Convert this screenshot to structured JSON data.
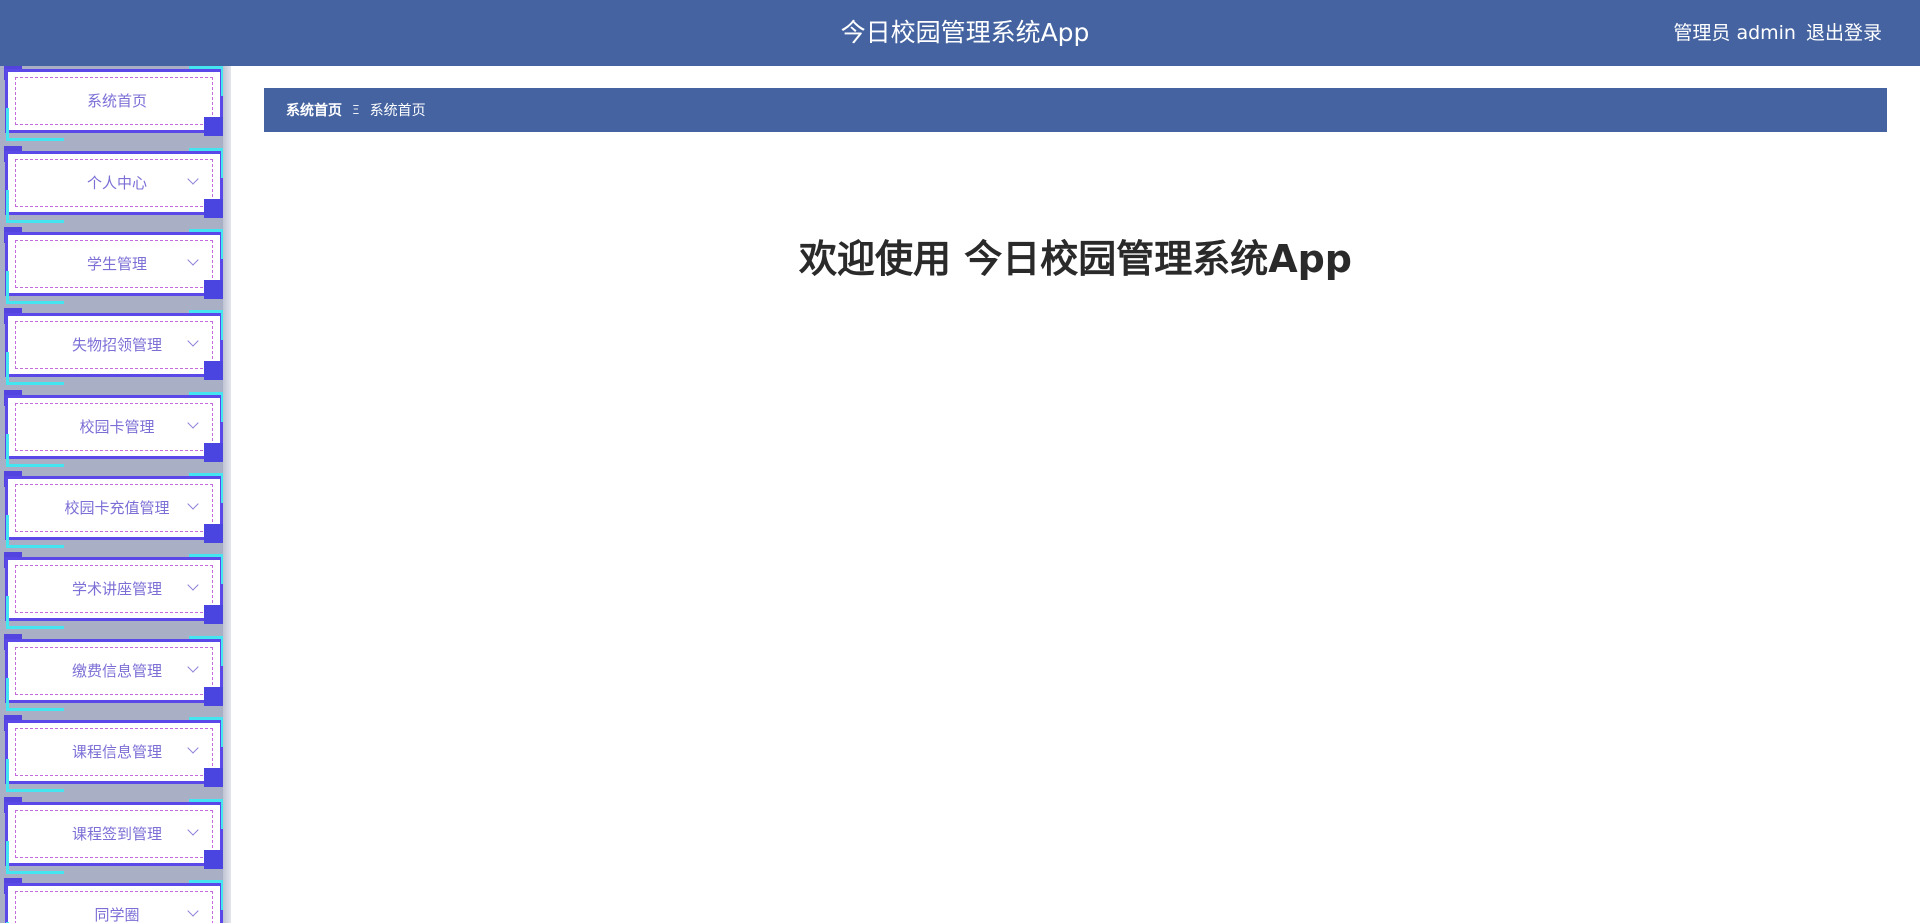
{
  "header": {
    "title": "今日校园管理系统App",
    "user_label": "管理员 admin",
    "logout_label": "退出登录"
  },
  "sidebar": {
    "items": [
      {
        "label": "系统首页",
        "has_children": false
      },
      {
        "label": "个人中心",
        "has_children": true
      },
      {
        "label": "学生管理",
        "has_children": true
      },
      {
        "label": "失物招领管理",
        "has_children": true
      },
      {
        "label": "校园卡管理",
        "has_children": true
      },
      {
        "label": "校园卡充值管理",
        "has_children": true
      },
      {
        "label": "学术讲座管理",
        "has_children": true
      },
      {
        "label": "缴费信息管理",
        "has_children": true
      },
      {
        "label": "课程信息管理",
        "has_children": true
      },
      {
        "label": "课程签到管理",
        "has_children": true
      },
      {
        "label": "同学圈",
        "has_children": true
      }
    ]
  },
  "breadcrumb": {
    "home": "系统首页",
    "separator": "Ξ",
    "current": "系统首页"
  },
  "main": {
    "welcome": "欢迎使用 今日校园管理系统App"
  },
  "colors": {
    "header_bg": "#4463a0",
    "sidebar_bg": "#a9b0c5",
    "menu_border": "#5a49e8",
    "menu_accent": "#44e4f0",
    "menu_text": "#7b6fd6"
  }
}
